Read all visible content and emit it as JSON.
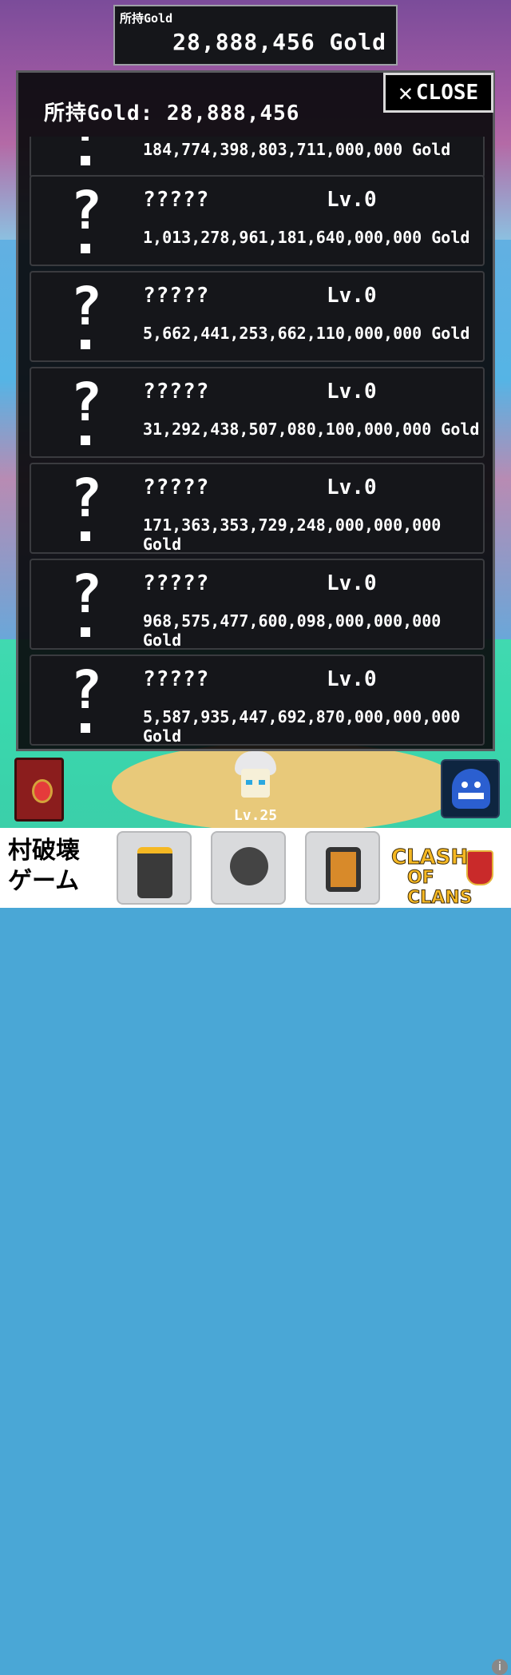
{
  "topbar": {
    "label": "所持Gold",
    "value": "28,888,456 Gold"
  },
  "panel": {
    "title": "所持Gold: 28,888,456",
    "close_label": "CLOSE"
  },
  "items": [
    {
      "name": "",
      "level": "",
      "cost": "184,774,398,803,711,000,000 Gold"
    },
    {
      "name": "?????",
      "level": "Lv.0",
      "cost": "1,013,278,961,181,640,000,000 Gold"
    },
    {
      "name": "?????",
      "level": "Lv.0",
      "cost": "5,662,441,253,662,110,000,000 Gold"
    },
    {
      "name": "?????",
      "level": "Lv.0",
      "cost": "31,292,438,507,080,100,000,000 Gold"
    },
    {
      "name": "?????",
      "level": "Lv.0",
      "cost": "171,363,353,729,248,000,000,000 Gold"
    },
    {
      "name": "?????",
      "level": "Lv.0",
      "cost": "968,575,477,600,098,000,000,000 Gold"
    },
    {
      "name": "?????",
      "level": "Lv.0",
      "cost": "5,587,935,447,692,870,000,000,000 Gold"
    }
  ],
  "hero": {
    "level": "Lv.25"
  },
  "ad": {
    "left_line1": "村破壊",
    "left_line2": "ゲーム",
    "brand_line1": "CLASH",
    "brand_line2": "OF CLANS",
    "info": "i"
  }
}
